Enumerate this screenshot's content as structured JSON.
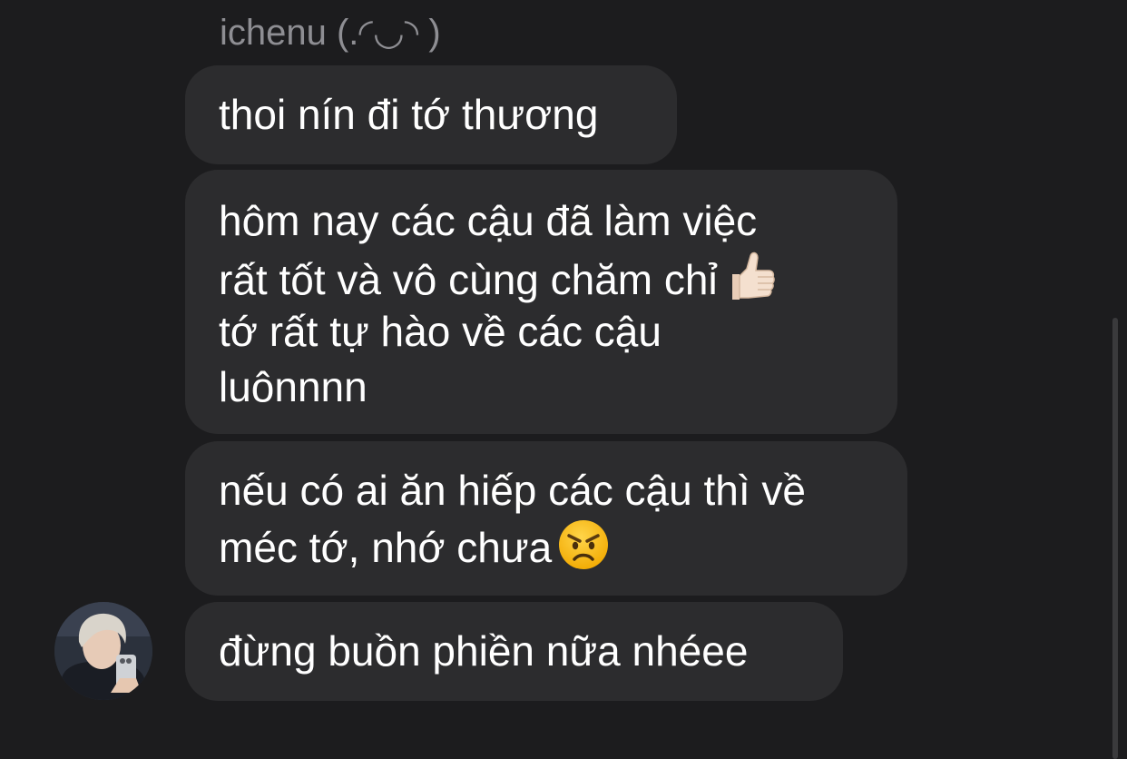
{
  "conversation": {
    "sender_name": "ichenu (.◜◡◝ )",
    "messages": [
      {
        "lines": [
          "thoi nín đi tớ thương"
        ]
      },
      {
        "lines": [
          "hôm nay các cậu đã làm việc",
          "rất tốt và vô cùng chăm chỉ",
          "tớ rất tự hào về các cậu",
          "luônnnn"
        ],
        "emoji": "thumbs-up-icon"
      },
      {
        "lines": [
          "nếu có ai ăn hiếp các cậu thì về",
          "méc tớ, nhớ chưa"
        ],
        "emoji": "angry-face-icon"
      },
      {
        "lines": [
          "đừng buồn phiền nữa nhéee"
        ]
      }
    ]
  },
  "colors": {
    "background": "#1c1c1e",
    "bubble": "#2c2c2e",
    "sender_name": "#8e8e93",
    "text": "#ffffff"
  }
}
